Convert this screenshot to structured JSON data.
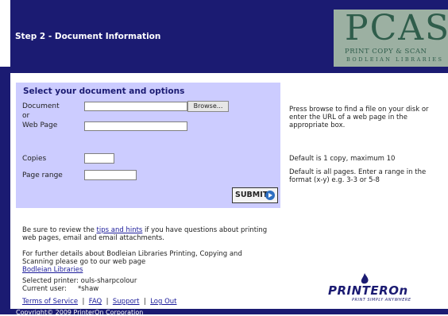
{
  "header": {
    "step_title": "Step 2 - Document Information",
    "logo": {
      "big": "PCAS",
      "line1": "PRINT COPY & SCAN",
      "line2": "BODLEIAN LIBRARIES"
    }
  },
  "form": {
    "title": "Select your document and options",
    "document_label": "Document",
    "or_label": "or",
    "webpage_label": "Web Page",
    "browse_label": "Browse...",
    "copies_label": "Copies",
    "page_range_label": "Page range",
    "submit_label": "SUBMIT",
    "document_value": "",
    "webpage_value": "",
    "copies_value": "",
    "page_range_value": ""
  },
  "hints": {
    "browse": "Press browse to find a file on your disk or enter the URL of a web page in the appropriate box.",
    "copies": "Default is 1 copy, maximum 10",
    "range": "Default is all pages. Enter a range in the format (x-y) e.g. 3-3 or 5-8"
  },
  "info": {
    "review_pre": "Be sure to review the ",
    "review_link": "tips and hints",
    "review_post": " if you have questions about printing web pages, email and email attachments.",
    "details": "For further details about Bodleian Libraries Printing, Copying and Scanning please go to our web page",
    "details_link": "Bodleian Libraries",
    "printer_label": "Selected printer:",
    "printer_value": "ouls-sharpcolour",
    "user_label": "Current user:",
    "user_value": "*shaw"
  },
  "footer": {
    "links": [
      "Terms of Service",
      "FAQ",
      "Support",
      "Log Out"
    ],
    "separator": "|",
    "copyright": "Copyright© 2009 PrinterOn Corporation"
  },
  "printeron": {
    "word1": "PRINTER",
    "word2": "On",
    "tagline": "PRINT SIMPLY ANYWHERE"
  },
  "colors": {
    "navy": "#1b1b72",
    "panel": "#ccccff",
    "logo_bg": "#9cb0a2"
  }
}
